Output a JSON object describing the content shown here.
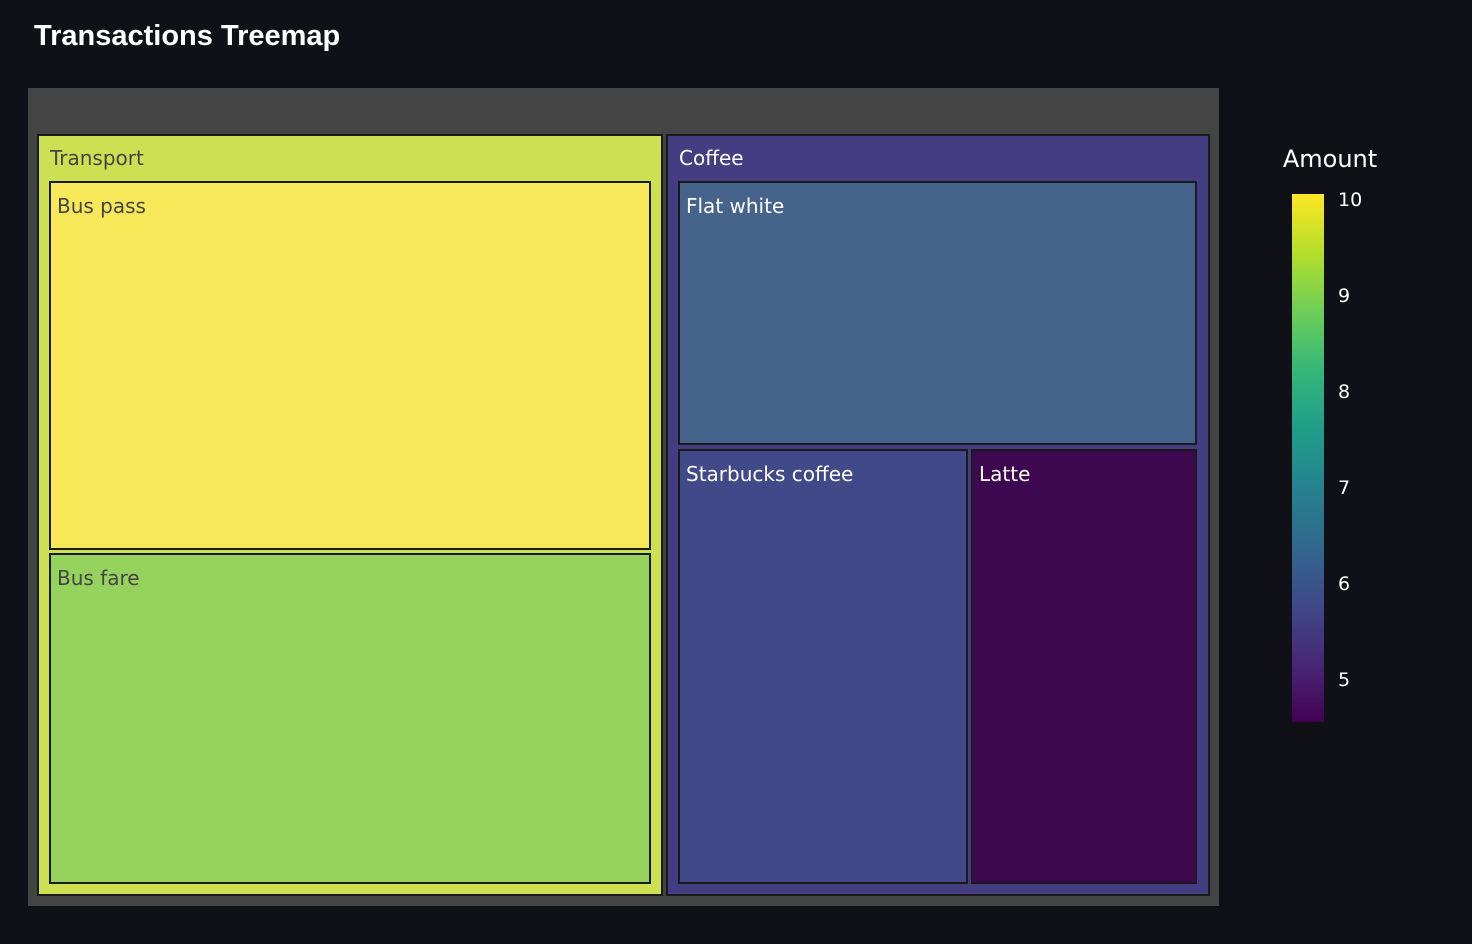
{
  "page": {
    "title": "Transactions Treemap"
  },
  "chart_data": {
    "type": "treemap",
    "title": "",
    "color_metric": "Amount",
    "colorscale": "viridis",
    "colorbar": {
      "title": "Amount",
      "range": [
        4.55,
        10.05
      ],
      "ticks": [
        10,
        9,
        8,
        7,
        6,
        5
      ]
    },
    "root": {
      "name": "",
      "color": "#444444"
    },
    "groups": [
      {
        "name": "Transport",
        "amount": 9.5,
        "color": "#cde052",
        "children": [
          {
            "name": "Bus pass",
            "amount": 10,
            "color": "#f7e859"
          },
          {
            "name": "Bus fare",
            "amount": 9,
            "color": "#96d35e"
          }
        ]
      },
      {
        "name": "Coffee",
        "amount": 5.6,
        "color": "#443d81",
        "children": [
          {
            "name": "Flat white",
            "amount": 6.3,
            "color": "#45638b"
          },
          {
            "name": "Starbucks coffee",
            "amount": 5.7,
            "color": "#414988"
          },
          {
            "name": "Latte",
            "amount": 4.6,
            "color": "#3d084f"
          }
        ]
      }
    ]
  }
}
